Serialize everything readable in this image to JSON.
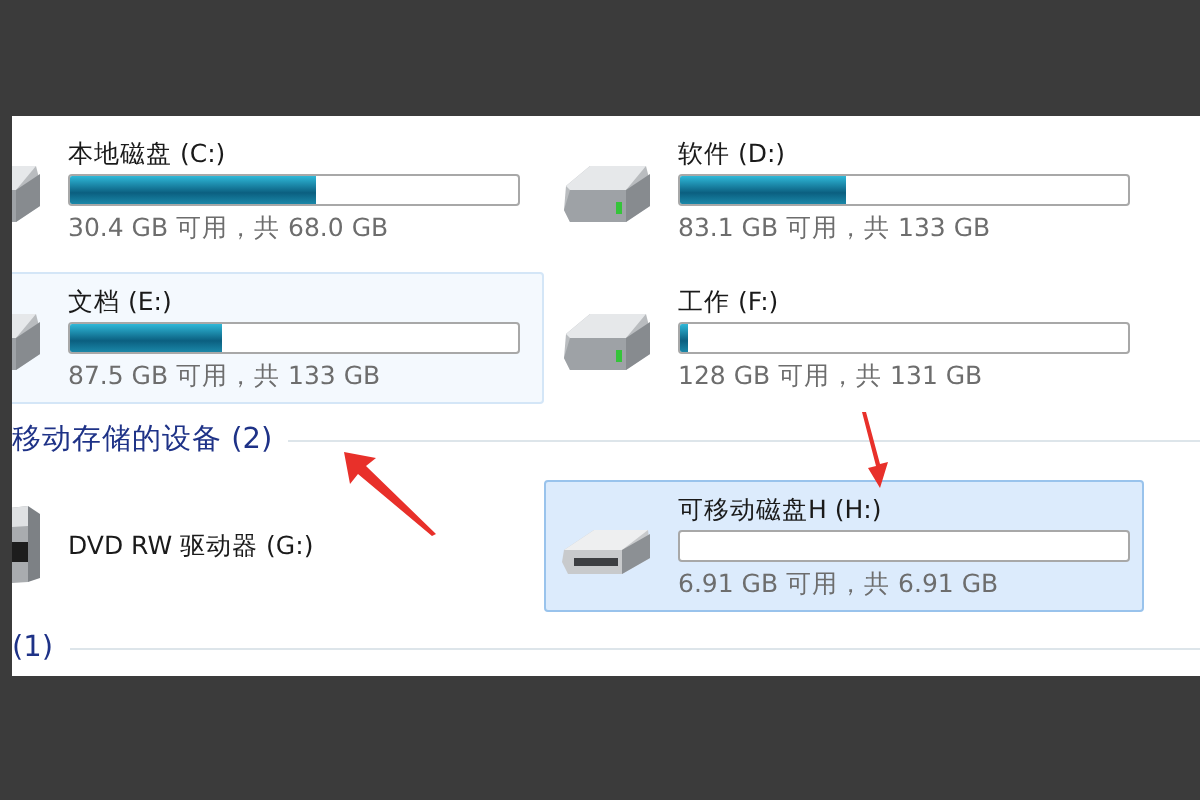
{
  "hard_drives": [
    {
      "kind": "hdd",
      "name": "本地磁盘 (C:)",
      "level": 0.55,
      "reading": "30.4 GB 可用，共 68.0 GB",
      "hovered": false,
      "selected": false
    },
    {
      "kind": "hdd",
      "name": "软件 (D:)",
      "level": 0.37,
      "reading": "83.1 GB 可用，共 133 GB",
      "hovered": false,
      "selected": false
    },
    {
      "kind": "hdd",
      "name": "文档 (E:)",
      "level": 0.34,
      "reading": "87.5 GB 可用，共 133 GB",
      "hovered": true,
      "selected": false
    },
    {
      "kind": "hdd",
      "name": "工作 (F:)",
      "level": 0.02,
      "reading": "128 GB 可用，共 131 GB",
      "hovered": false,
      "selected": false
    }
  ],
  "removable_section": {
    "title": "移动存储的设备 (2)"
  },
  "removable": [
    {
      "kind": "dvd",
      "name": "DVD RW 驱动器 (G:)",
      "hovered": false,
      "selected": false
    },
    {
      "kind": "usb",
      "name": "可移动磁盘H (H:)",
      "level": 0.0,
      "reading": "6.91 GB 可用，共 6.91 GB",
      "hovered": false,
      "selected": true
    }
  ],
  "next_section": {
    "title": "(1)"
  }
}
